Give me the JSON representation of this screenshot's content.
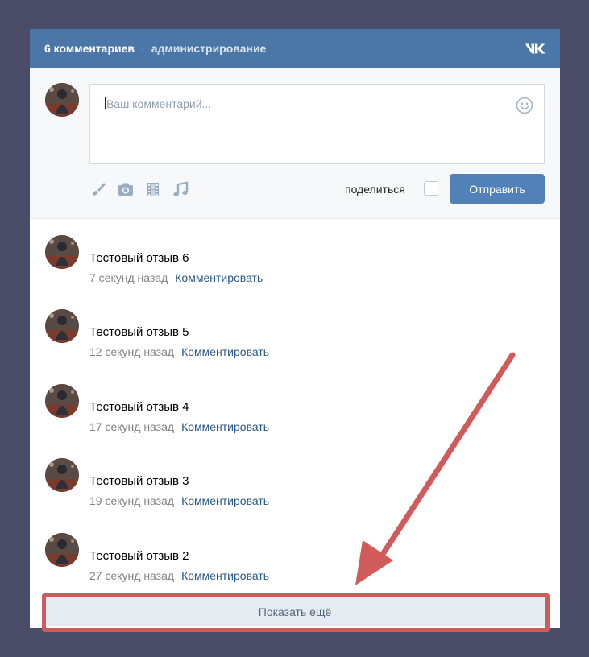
{
  "header": {
    "count_label": "6 комментариев",
    "separator": "·",
    "admin_link": "администрирование",
    "logo": "vk-logo"
  },
  "compose": {
    "placeholder": "Ваш комментарий...",
    "share_label": "поделиться",
    "send_label": "Отправить",
    "attach_icons": [
      "brush-icon",
      "camera-icon",
      "film-icon",
      "music-icon"
    ]
  },
  "comments": [
    {
      "text": "Тестовый отзыв 6",
      "time": "7 секунд назад",
      "reply": "Комментировать"
    },
    {
      "text": "Тестовый отзыв 5",
      "time": "12 секунд назад",
      "reply": "Комментировать"
    },
    {
      "text": "Тестовый отзыв 4",
      "time": "17 секунд назад",
      "reply": "Комментировать"
    },
    {
      "text": "Тестовый отзыв 3",
      "time": "19 секунд назад",
      "reply": "Комментировать"
    },
    {
      "text": "Тестовый отзыв 2",
      "time": "27 секунд назад",
      "reply": "Комментировать"
    }
  ],
  "show_more_label": "Показать ещё",
  "colors": {
    "page_bg": "#4a4c68",
    "header_bg": "#4a76a8",
    "send_button": "#5181b8",
    "link": "#2a5885",
    "annotation": "#d15b5b"
  }
}
